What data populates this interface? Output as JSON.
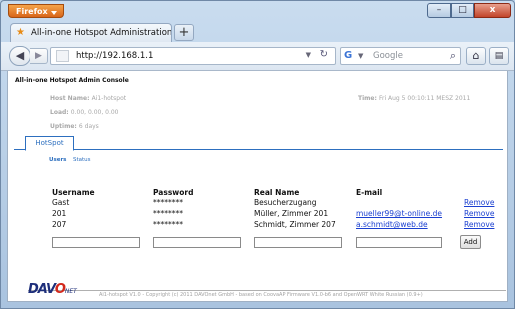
{
  "browser": {
    "app_button": "Firefox",
    "tab_title": "All-in-one Hotspot Administration (Ai1-...",
    "new_tab": "+",
    "url": "http://192.168.1.1",
    "search_placeholder": "Google",
    "window_controls": {
      "minimize": "–",
      "maximize": "□",
      "close": "x"
    }
  },
  "page": {
    "console_title": "All-in-one Hotspot Admin Console",
    "host_label": "Host Name:",
    "host_value": "Ai1-hotspot",
    "load_label": "Load:",
    "load_value": "0.00, 0.00, 0.00",
    "uptime_label": "Uptime:",
    "uptime_value": "6 days",
    "time_label": "Time:",
    "time_value": "Fri Aug 5 00:10:11 MESZ 2011",
    "main_tab": "HotSpot",
    "subtabs": {
      "users": "Users",
      "status": "Status"
    },
    "table": {
      "headers": {
        "username": "Username",
        "password": "Password",
        "realname": "Real Name",
        "email": "E-mail"
      },
      "rows": [
        {
          "username": "Gast",
          "password": "********",
          "realname": "Besucherzugang",
          "email": "",
          "action": "Remove"
        },
        {
          "username": "201",
          "password": "********",
          "realname": "Müller, Zimmer 201",
          "email": "mueller99@t-online.de",
          "action": "Remove"
        },
        {
          "username": "207",
          "password": "********",
          "realname": "Schmidt, Zimmer 207",
          "email": "a.schmidt@web.de",
          "action": "Remove"
        }
      ],
      "add_label": "Add"
    },
    "footer": {
      "logo_main": "DAV",
      "logo_o": "O",
      "logo_net": "NET",
      "copyright": "Ai1-hotspot V1.0 - Copyright (c) 2011 DAVOnet GmbH - based on CoovaAP Firmware V1.0-b6 and OpenWRT White Russian (0.9+)"
    }
  },
  "icons": [
    "firefox-menu-icon",
    "favicon-icon",
    "back-arrow-icon",
    "forward-arrow-icon",
    "site-identity-icon",
    "reload-icon",
    "google-icon",
    "search-magnifier-icon",
    "home-icon",
    "bookmarks-icon"
  ]
}
